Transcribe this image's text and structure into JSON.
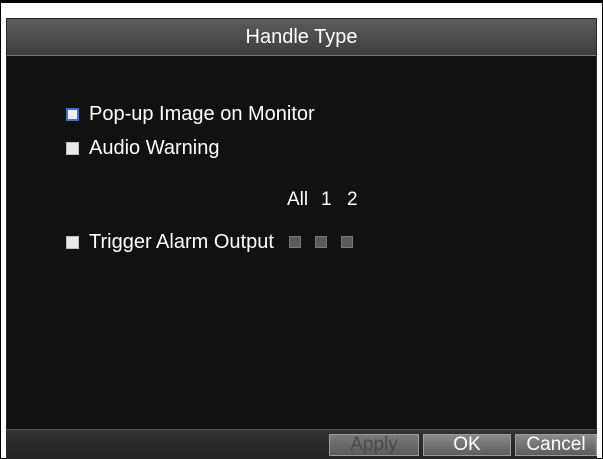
{
  "dialog": {
    "title": "Handle Type"
  },
  "options": {
    "popup_label": "Pop-up Image on Monitor",
    "audio_label": "Audio Warning",
    "trigger_label": "Trigger Alarm Output"
  },
  "alarm_outputs": {
    "headers": [
      "All",
      "1",
      "2"
    ]
  },
  "buttons": {
    "apply": "Apply",
    "ok": "OK",
    "cancel": "Cancel"
  },
  "colors": {
    "background": "#111111",
    "titlebar": "#4a4a4a",
    "focus_border": "#3a6fd6"
  }
}
